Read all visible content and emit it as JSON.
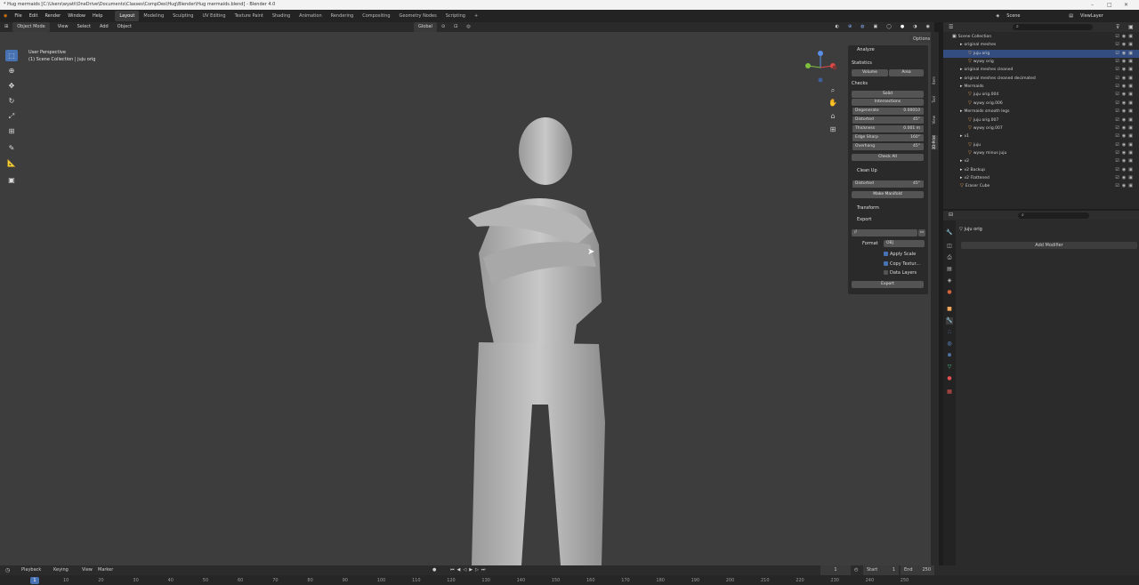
{
  "titlebar": {
    "text": "* Hug mermaids [C:\\Users\\wyatt\\OneDrive\\Documents\\Classes\\CompDes\\Hug\\Blender\\Hug mermaids.blend] - Blender 4.0",
    "min": "–",
    "max": "□",
    "close": "✕"
  },
  "menu": {
    "items": [
      "File",
      "Edit",
      "Render",
      "Window",
      "Help"
    ]
  },
  "workspaces": [
    "Layout",
    "Modeling",
    "Sculpting",
    "UV Editing",
    "Texture Paint",
    "Shading",
    "Animation",
    "Rendering",
    "Compositing",
    "Geometry Nodes",
    "Scripting",
    "+"
  ],
  "scene": {
    "label": "Scene",
    "view_layer": "ViewLayer"
  },
  "viewport_header": {
    "mode": "Object Mode",
    "items": [
      "View",
      "Select",
      "Add",
      "Object"
    ],
    "orientation": "Global",
    "options": "Options"
  },
  "overlay": {
    "line1": "User Perspective",
    "line2": "(1) Scene Collection | juju orig"
  },
  "npanel": {
    "analyze": "Analyze",
    "statistics": "Statistics",
    "volume": "Volume",
    "area": "Area",
    "checks": "Checks",
    "solid": "Solid",
    "intersections": "Intersections",
    "rows": [
      {
        "k": "Degenerate",
        "v": "0.00010"
      },
      {
        "k": "Distorted",
        "v": "45°"
      },
      {
        "k": "Thickness",
        "v": "0.001 m"
      },
      {
        "k": "Edge Sharp",
        "v": "160°"
      },
      {
        "k": "Overhang",
        "v": "45°"
      }
    ],
    "check_all": "Check All",
    "clean_up": "Clean Up",
    "distorted": "Distorted",
    "distorted_val": "45°",
    "make_manifold": "Make Manifold",
    "transform": "Transform",
    "export": "Export",
    "path": "//",
    "format_label": "Format",
    "format_val": "OBJ",
    "apply_scale": "Apply Scale",
    "copy_textures": "Copy Textur...",
    "data_layers": "Data Layers",
    "export_btn": "Export"
  },
  "side_tabs": [
    "Item",
    "Tool",
    "View",
    "3D-Print"
  ],
  "outliner": {
    "search_placeholder": "",
    "rows": [
      {
        "label": "Scene Collection",
        "indent": 0,
        "icon": "▣",
        "color": "#dddddd",
        "sel": false
      },
      {
        "label": "original meshes",
        "indent": 1,
        "icon": "▸",
        "color": "#dddddd",
        "sel": false
      },
      {
        "label": "juju orig",
        "indent": 2,
        "icon": "▽",
        "color": "#f2a65a",
        "sel": true
      },
      {
        "label": "wywy orig",
        "indent": 2,
        "icon": "▽",
        "color": "#f2a65a",
        "sel": false
      },
      {
        "label": "original meshes cleaned",
        "indent": 1,
        "icon": "▸",
        "color": "#dddddd",
        "sel": false
      },
      {
        "label": "original meshes cleaned decimated",
        "indent": 1,
        "icon": "▸",
        "color": "#dddddd",
        "sel": false
      },
      {
        "label": "Mermaids",
        "indent": 1,
        "icon": "▸",
        "color": "#dddddd",
        "sel": false
      },
      {
        "label": "juju orig.004",
        "indent": 2,
        "icon": "▽",
        "color": "#f2a65a",
        "sel": false
      },
      {
        "label": "wywy orig.006",
        "indent": 2,
        "icon": "▽",
        "color": "#f2a65a",
        "sel": false
      },
      {
        "label": "Mermaids smooth legs",
        "indent": 1,
        "icon": "▸",
        "color": "#dddddd",
        "sel": false
      },
      {
        "label": "juju orig.007",
        "indent": 2,
        "icon": "▽",
        "color": "#f2a65a",
        "sel": false
      },
      {
        "label": "wywy orig.007",
        "indent": 2,
        "icon": "▽",
        "color": "#f2a65a",
        "sel": false
      },
      {
        "label": "v1",
        "indent": 1,
        "icon": "▸",
        "color": "#dddddd",
        "sel": false
      },
      {
        "label": "juju",
        "indent": 2,
        "icon": "▽",
        "color": "#f2a65a",
        "sel": false
      },
      {
        "label": "wywy minus juju",
        "indent": 2,
        "icon": "▽",
        "color": "#f2a65a",
        "sel": false
      },
      {
        "label": "v2",
        "indent": 1,
        "icon": "▸",
        "color": "#dddddd",
        "sel": false
      },
      {
        "label": "v2 Backup",
        "indent": 1,
        "icon": "▸",
        "color": "#dddddd",
        "sel": false
      },
      {
        "label": "v2 Flattened",
        "indent": 1,
        "icon": "▸",
        "color": "#dddddd",
        "sel": false
      },
      {
        "label": "Eraser Cube",
        "indent": 1,
        "icon": "▽",
        "color": "#f2a65a",
        "sel": false
      }
    ]
  },
  "properties": {
    "object_name": "juju orig",
    "add_modifier": "Add Modifier"
  },
  "timeline": {
    "items": [
      "Playback",
      "Keying",
      "View",
      "Marker"
    ],
    "current_frame": "1",
    "start_label": "Start",
    "start": "1",
    "end_label": "End",
    "end": "250",
    "ticks": [
      "10",
      "20",
      "30",
      "40",
      "50",
      "60",
      "70",
      "80",
      "90",
      "100",
      "110",
      "120",
      "130",
      "140",
      "150",
      "160",
      "170",
      "180",
      "190",
      "200",
      "210",
      "220",
      "230",
      "240",
      "250"
    ]
  },
  "colors": {
    "accent": "#4772b3",
    "selection": "#334d80",
    "mesh": "#f2a65a",
    "viewport": "#3d3d3d"
  }
}
